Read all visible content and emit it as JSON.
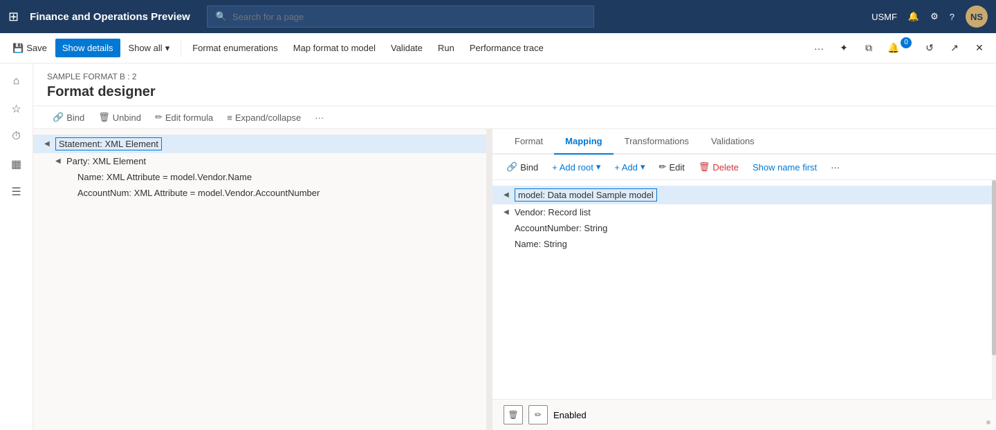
{
  "app": {
    "title": "Finance and Operations Preview",
    "env": "USMF"
  },
  "navbar": {
    "search_placeholder": "Search for a page",
    "avatar_initials": "NS"
  },
  "commandbar": {
    "save_label": "Save",
    "show_details_label": "Show details",
    "show_all_label": "Show all",
    "format_enumerations_label": "Format enumerations",
    "map_format_label": "Map format to model",
    "validate_label": "Validate",
    "run_label": "Run",
    "performance_trace_label": "Performance trace"
  },
  "page": {
    "breadcrumb": "SAMPLE FORMAT B : 2",
    "title": "Format designer"
  },
  "editor_toolbar": {
    "bind_label": "Bind",
    "unbind_label": "Unbind",
    "edit_formula_label": "Edit formula",
    "expand_collapse_label": "Expand/collapse"
  },
  "tree": {
    "items": [
      {
        "label": "Statement: XML Element",
        "indent": 0,
        "selected": true
      },
      {
        "label": "Party: XML Element",
        "indent": 1,
        "selected": false
      },
      {
        "label": "Name: XML Attribute = model.Vendor.Name",
        "indent": 2,
        "selected": false
      },
      {
        "label": "AccountNum: XML Attribute = model.Vendor.AccountNumber",
        "indent": 2,
        "selected": false
      }
    ]
  },
  "mapping_tabs": [
    {
      "label": "Format",
      "active": false
    },
    {
      "label": "Mapping",
      "active": true
    },
    {
      "label": "Transformations",
      "active": false
    },
    {
      "label": "Validations",
      "active": false
    }
  ],
  "mapping_toolbar": {
    "bind_label": "Bind",
    "add_root_label": "+ Add root",
    "add_label": "+ Add",
    "edit_label": "Edit",
    "delete_label": "Delete",
    "show_name_first_label": "Show name first"
  },
  "mapping_tree": {
    "items": [
      {
        "label": "model: Data model Sample model",
        "indent": 0,
        "selected": true
      },
      {
        "label": "Vendor: Record list",
        "indent": 1,
        "selected": false
      },
      {
        "label": "AccountNumber: String",
        "indent": 2,
        "selected": false
      },
      {
        "label": "Name: String",
        "indent": 2,
        "selected": false
      }
    ]
  },
  "bottom_strip": {
    "status": "Enabled"
  }
}
